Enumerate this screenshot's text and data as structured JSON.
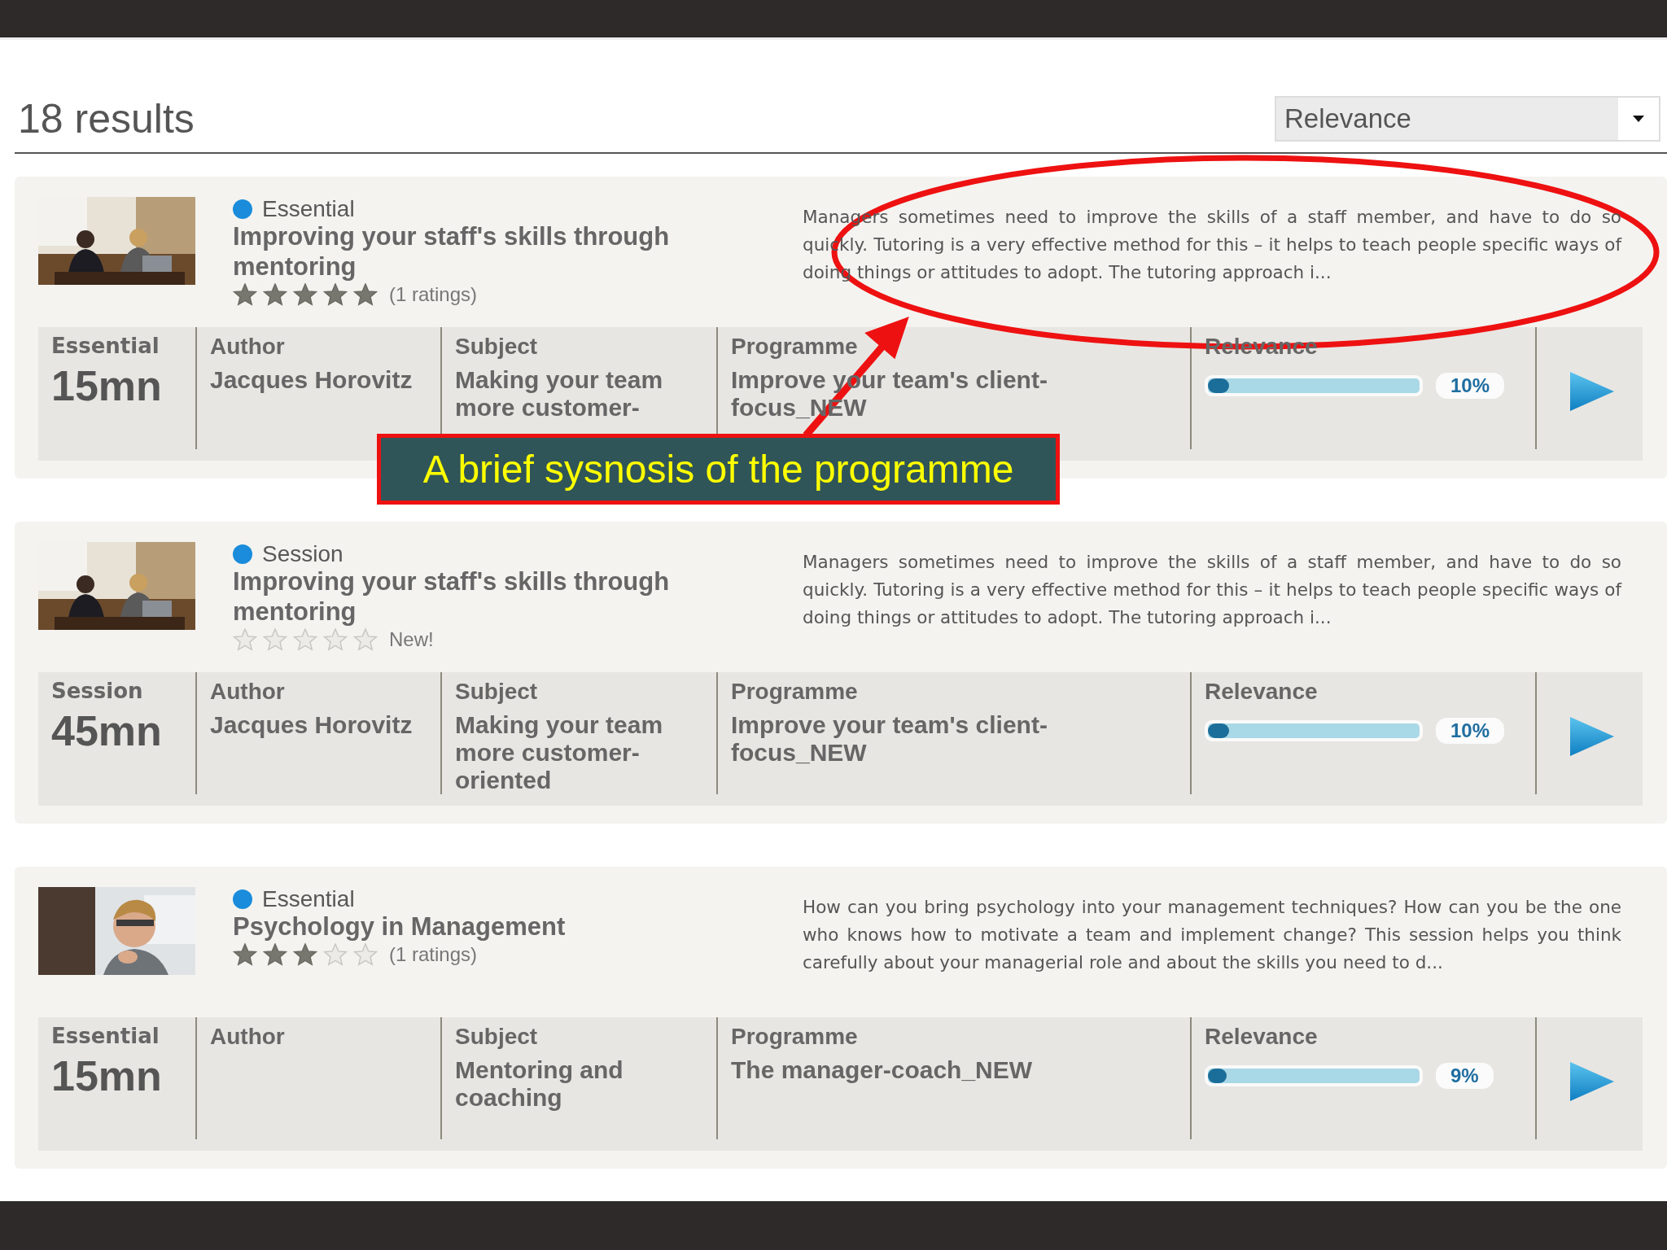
{
  "results_count": "18 results",
  "sort": {
    "value": "Relevance"
  },
  "results": [
    {
      "type": "Essential",
      "title": "Improving your staff's skills through mentoring",
      "stars": 5,
      "rating_note": "(1 ratings)",
      "synopsis": "Managers sometimes need to improve the skills of a staff member, and have to do so quickly. Tutoring is a very effective method for this – it helps to teach people specific ways of doing things or attitudes to adopt. The tutoring approach i...",
      "duration_label": "Essential",
      "duration": "15mn",
      "author_label": "Author",
      "author": "Jacques Horovitz",
      "subject_label": "Subject",
      "subject": "Making your team more customer-",
      "programme_label": "Programme",
      "programme": "Improve your team's client-focus_NEW",
      "relevance_label": "Relevance",
      "level": 0.1,
      "relevance": "10%"
    },
    {
      "type": "Session",
      "title": "Improving your staff's skills through mentoring",
      "stars": 0,
      "rating_note": "New!",
      "synopsis": "Managers sometimes need to improve the skills of a staff member, and have to do so quickly. Tutoring is a very effective method for this – it helps to teach people specific ways of doing things or attitudes to adopt. The tutoring approach i...",
      "duration_label": "Session",
      "duration": "45mn",
      "author_label": "Author",
      "author": "Jacques Horovitz",
      "subject_label": "Subject",
      "subject": "Making your team more customer-oriented",
      "programme_label": "Programme",
      "programme": "Improve your team's client-focus_NEW",
      "relevance_label": "Relevance",
      "level": 0.1,
      "relevance": "10%"
    },
    {
      "type": "Essential",
      "title": "Psychology in Management",
      "stars": 3,
      "rating_note": "(1 ratings)",
      "synopsis": "How can you bring psychology into your management techniques? How can you be the one who knows how to motivate a team and implement change? This session helps you think carefully about your managerial role and about the skills you need to d...",
      "duration_label": "Essential",
      "duration": "15mn",
      "author_label": "Author",
      "subject_label": "Subject",
      "subject": "Mentoring and coaching",
      "programme_label": "Programme",
      "programme": "The manager-coach_NEW",
      "relevance_label": "Relevance",
      "level": 0.09,
      "relevance": "9%"
    }
  ],
  "annotation": {
    "callout": "A brief sysnosis of the programme"
  }
}
